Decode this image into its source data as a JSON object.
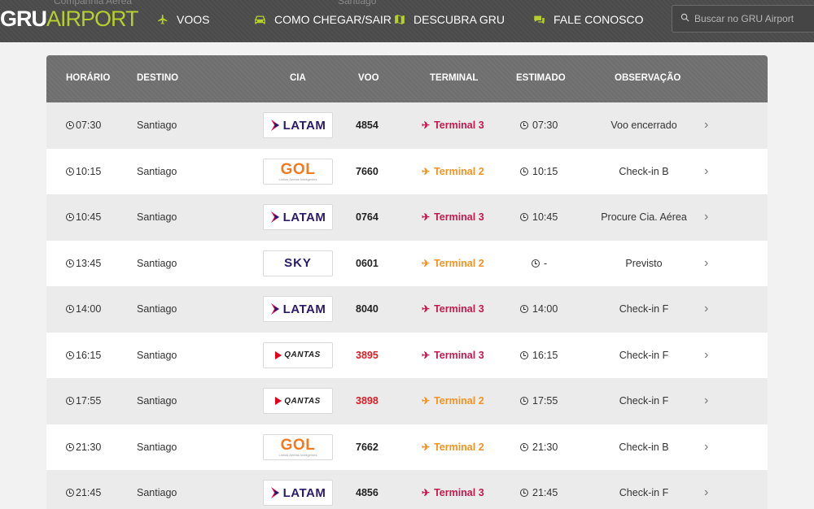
{
  "header": {
    "ghost_left": "Companhia Aérea",
    "ghost_right": "Santiago",
    "logo_primary": "GRU",
    "logo_secondary": "AIRPORT",
    "nav": [
      {
        "label": "VOOS",
        "icon": "airplane-icon"
      },
      {
        "label": "COMO CHEGAR/SAIR",
        "icon": "car-icon"
      },
      {
        "label": "DESCUBRA GRU",
        "icon": "map-icon"
      },
      {
        "label": "FALE CONOSCO",
        "icon": "chat-icon"
      }
    ],
    "search_placeholder": "Buscar no GRU Airport"
  },
  "table": {
    "columns": [
      "HORÁRIO",
      "DESTINO",
      "CIA",
      "VOO",
      "TERMINAL",
      "ESTIMADO",
      "OBSERVAÇÃO"
    ],
    "rows": [
      {
        "time": "07:30",
        "dest": "Santiago",
        "airline": "LATAM",
        "flight": "4854",
        "terminal": "Terminal 3",
        "estimated": "07:30",
        "obs": "Voo encerrado"
      },
      {
        "time": "10:15",
        "dest": "Santiago",
        "airline": "GOL",
        "flight": "7660",
        "terminal": "Terminal 2",
        "estimated": "10:15",
        "obs": "Check-in B"
      },
      {
        "time": "10:45",
        "dest": "Santiago",
        "airline": "LATAM",
        "flight": "0764",
        "terminal": "Terminal 3",
        "estimated": "10:45",
        "obs": "Procure Cia. Aérea"
      },
      {
        "time": "13:45",
        "dest": "Santiago",
        "airline": "SKY",
        "flight": "0601",
        "terminal": "Terminal 2",
        "estimated": "-",
        "obs": "Previsto"
      },
      {
        "time": "14:00",
        "dest": "Santiago",
        "airline": "LATAM",
        "flight": "8040",
        "terminal": "Terminal 3",
        "estimated": "14:00",
        "obs": "Check-in F"
      },
      {
        "time": "16:15",
        "dest": "Santiago",
        "airline": "QANTAS",
        "flight": "3895",
        "terminal": "Terminal 3",
        "estimated": "16:15",
        "obs": "Check-in F"
      },
      {
        "time": "17:55",
        "dest": "Santiago",
        "airline": "QANTAS",
        "flight": "3898",
        "terminal": "Terminal 2",
        "estimated": "17:55",
        "obs": "Check-in F"
      },
      {
        "time": "21:30",
        "dest": "Santiago",
        "airline": "GOL",
        "flight": "7662",
        "terminal": "Terminal 2",
        "estimated": "21:30",
        "obs": "Check-in B"
      },
      {
        "time": "21:45",
        "dest": "Santiago",
        "airline": "LATAM",
        "flight": "4856",
        "terminal": "Terminal 3",
        "estimated": "21:45",
        "obs": "Check-in F"
      }
    ]
  },
  "logos": {
    "gol_word": "GOL",
    "gol_tagline": "Linhas Aéreas Inteligentes",
    "latam_word": "LATAM",
    "sky_word": "SKY",
    "qantas_word": "QANTAS"
  },
  "colors": {
    "accent": "#b7cf2d",
    "terminal_3": "#c4184f",
    "terminal_2": "#f29321",
    "flight_highlight": "#d61f26"
  }
}
